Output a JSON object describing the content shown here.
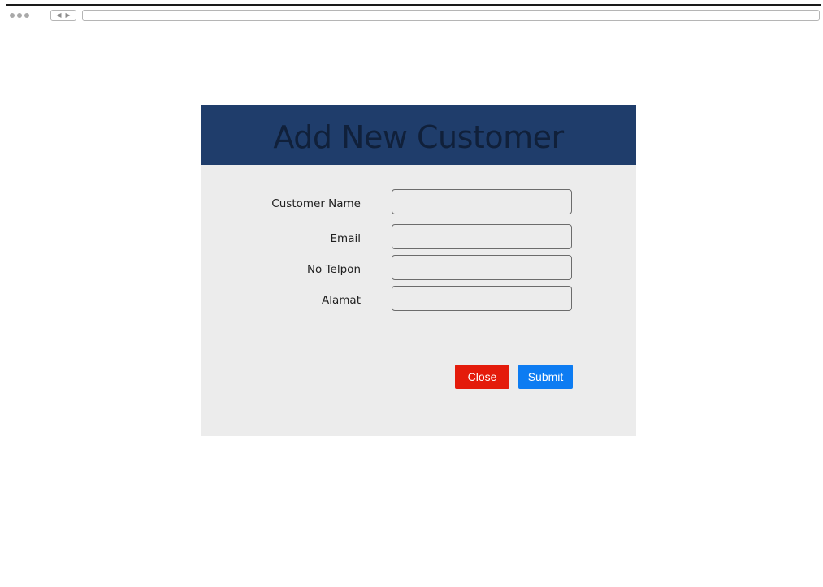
{
  "browser": {
    "nav_back_icon": "chevron-left-icon",
    "nav_forward_icon": "chevron-right-icon",
    "url": ""
  },
  "modal": {
    "title": "Add New Customer",
    "header_color": "#1f3d6b",
    "fields": [
      {
        "label": "Customer Name",
        "value": "",
        "placeholder": ""
      },
      {
        "label": "Email",
        "value": "",
        "placeholder": ""
      },
      {
        "label": "No Telpon",
        "value": "",
        "placeholder": ""
      },
      {
        "label": "Alamat",
        "value": "",
        "placeholder": ""
      }
    ],
    "buttons": {
      "close_label": "Close",
      "close_color": "#e41b0b",
      "submit_label": "Submit",
      "submit_color": "#0d7cf2"
    }
  }
}
